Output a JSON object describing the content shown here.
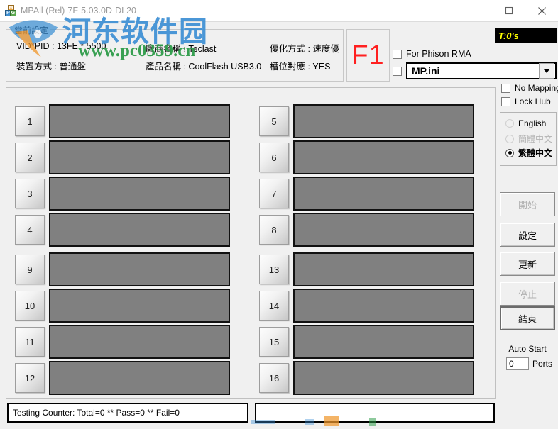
{
  "window": {
    "title": "MPAll (Rel)-7F-5.03.0D-DL20",
    "icon": "mpg-app-icon",
    "minimize_label": "minimize",
    "maximize_label": "maximize",
    "close_label": "close"
  },
  "watermark": {
    "chinese": "河东软件园",
    "url": "www.pc0359.cn",
    "blue": "#3c8fd4",
    "green": "#2f9c4a",
    "orange": "#f0972c"
  },
  "current_settings": {
    "title": "當前設定",
    "vid_pid": "VID*PID : 13FE * 5500",
    "device_mode": "裝置方式 : 普通盤",
    "vendor_name": "廠商名稱 : Teclast",
    "product_name": "產品名稱 : CoolFlash USB3.0",
    "optimize_mode": "優化方式 : 速度優",
    "slot_mapping": "槽位對應 : YES"
  },
  "f1": {
    "label": "F1",
    "color": "#ff2020"
  },
  "timer_badge": {
    "text": "T:0's",
    "fg": "#ffff00",
    "bg": "#000000"
  },
  "options": {
    "phison_rma": {
      "label": "For Phison RMA",
      "checked": false
    },
    "ini_checkbox": {
      "checked": false
    },
    "ini_file": {
      "value": "MP.ini"
    },
    "no_mapping": {
      "label": "No Mapping",
      "checked": false
    },
    "lock_hub": {
      "label": "Lock Hub",
      "checked": false
    }
  },
  "language": {
    "options": [
      {
        "label": "English",
        "selected": false,
        "enabled": true
      },
      {
        "label": "簡體中文",
        "selected": false,
        "enabled": false
      },
      {
        "label": "繁體中文",
        "selected": true,
        "enabled": true
      }
    ]
  },
  "buttons": {
    "start": {
      "label": "開始",
      "enabled": false
    },
    "config": {
      "label": "設定",
      "enabled": true
    },
    "update": {
      "label": "更新",
      "enabled": true
    },
    "stop": {
      "label": "停止",
      "enabled": false
    },
    "exit": {
      "label": "結束",
      "enabled": true
    }
  },
  "auto_start": {
    "label": "Auto Start",
    "value": "0",
    "units": "Ports"
  },
  "ports": {
    "group_a": [
      {
        "number": "1",
        "status": ""
      },
      {
        "number": "2",
        "status": ""
      },
      {
        "number": "3",
        "status": ""
      },
      {
        "number": "4",
        "status": ""
      }
    ],
    "group_b": [
      {
        "number": "5",
        "status": ""
      },
      {
        "number": "6",
        "status": ""
      },
      {
        "number": "7",
        "status": ""
      },
      {
        "number": "8",
        "status": ""
      }
    ],
    "group_c": [
      {
        "number": "9",
        "status": ""
      },
      {
        "number": "10",
        "status": ""
      },
      {
        "number": "11",
        "status": ""
      },
      {
        "number": "12",
        "status": ""
      }
    ],
    "group_d": [
      {
        "number": "13",
        "status": ""
      },
      {
        "number": "14",
        "status": ""
      },
      {
        "number": "15",
        "status": ""
      },
      {
        "number": "16",
        "status": ""
      }
    ]
  },
  "footer": {
    "counter": "Testing Counter: Total=0 ** Pass=0 ** Fail=0",
    "log": ""
  }
}
